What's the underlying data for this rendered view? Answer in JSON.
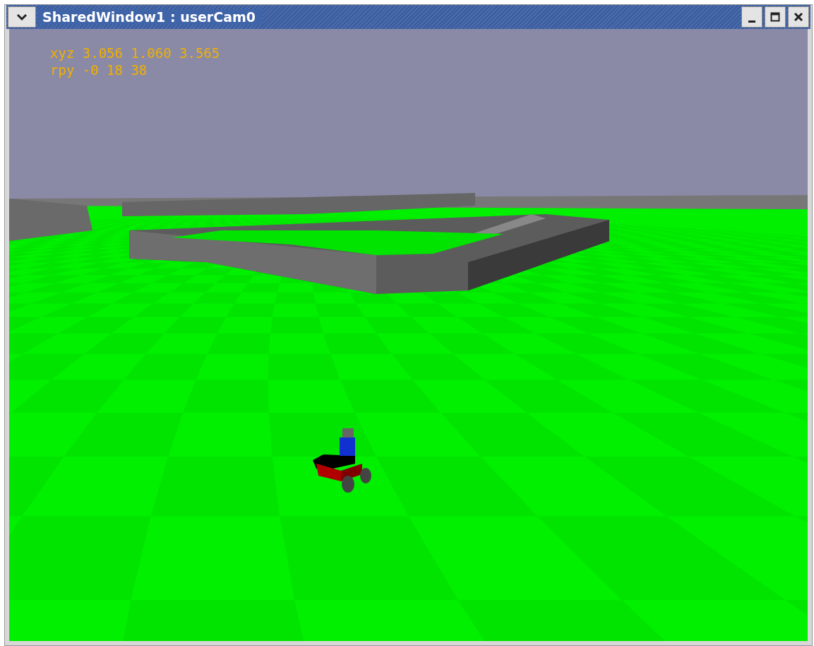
{
  "window": {
    "title": "SharedWindow1 : userCam0"
  },
  "viewport": {
    "readouts": [
      "xyz 3.056 1.060 3.565",
      "rpy -0 18 38"
    ]
  }
}
